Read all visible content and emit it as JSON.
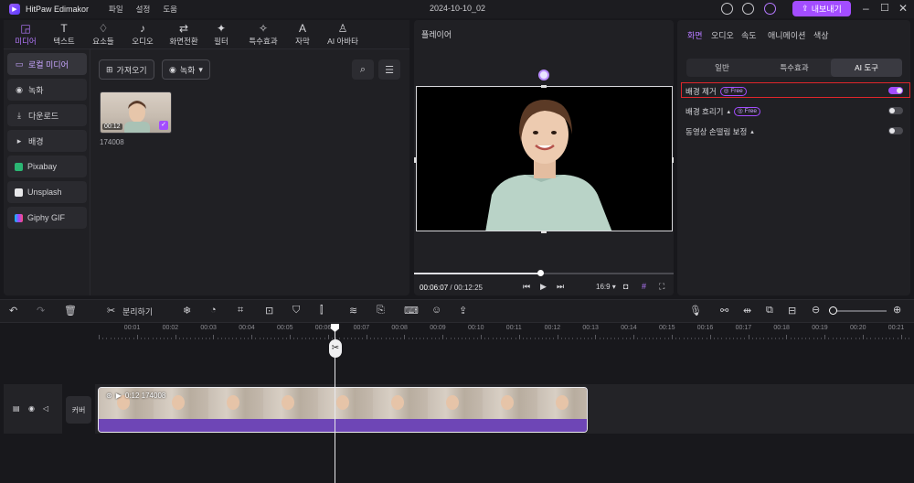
{
  "titlebar": {
    "app_name": "HitPaw Edimakor",
    "menu": [
      "파일",
      "설정",
      "도움"
    ],
    "project": "2024-10-10_02",
    "export_label": "내보내기"
  },
  "toolbar": {
    "tools": [
      {
        "label": "미디어",
        "icon": "media-icon"
      },
      {
        "label": "텍스트",
        "icon": "text-icon"
      },
      {
        "label": "요소들",
        "icon": "elements-icon"
      },
      {
        "label": "오디오",
        "icon": "audio-icon"
      },
      {
        "label": "화면전환",
        "icon": "transition-icon"
      },
      {
        "label": "필터",
        "icon": "filter-icon"
      },
      {
        "label": "특수효과",
        "icon": "effects-icon"
      },
      {
        "label": "자막",
        "icon": "subtitle-icon"
      },
      {
        "label": "AI 아바타",
        "icon": "ai-avatar-icon"
      }
    ]
  },
  "sidebar": {
    "items": [
      {
        "label": "로컬 미디어"
      },
      {
        "label": "녹화"
      },
      {
        "label": "다운로드"
      },
      {
        "label": "배경"
      },
      {
        "label": "Pixabay"
      },
      {
        "label": "Unsplash"
      },
      {
        "label": "Giphy GIF"
      }
    ]
  },
  "media": {
    "import_label": "가져오기",
    "record_label": "녹화",
    "clip_name": "174008",
    "clip_duration": "00:12"
  },
  "player": {
    "title": "플레이어",
    "current_time": "00:06:07",
    "total_time": "/ 00:12:25",
    "aspect": "16:9",
    "progress": 0.49
  },
  "properties": {
    "tabs": [
      "화면",
      "오디오",
      "속도",
      "애니메이션",
      "색상"
    ],
    "segments": [
      "일반",
      "특수효과",
      "AI 도구"
    ],
    "rows": [
      {
        "label": "배경 제거",
        "free": "Free",
        "on": true
      },
      {
        "label": "배경 흐리기",
        "free": "Free",
        "on": false
      },
      {
        "label": "동영상 손떨림 보정",
        "free": "",
        "on": false
      }
    ]
  },
  "timeline": {
    "split_label": "분리하기",
    "ruler": [
      "00:00",
      "00:01",
      "00:02",
      "00:03",
      "00:04",
      "00:05",
      "00:06",
      "00:07",
      "00:08",
      "00:09",
      "00:10",
      "00:11",
      "00:12",
      "00:13",
      "00:14",
      "00:15",
      "00:16",
      "00:17",
      "00:18",
      "00:19",
      "00:20",
      "00:21"
    ],
    "cover_label": "커버",
    "clip_label": "0:12 174008"
  },
  "colors": {
    "accent": "#a34dff",
    "highlight_border": "#e0262b"
  }
}
